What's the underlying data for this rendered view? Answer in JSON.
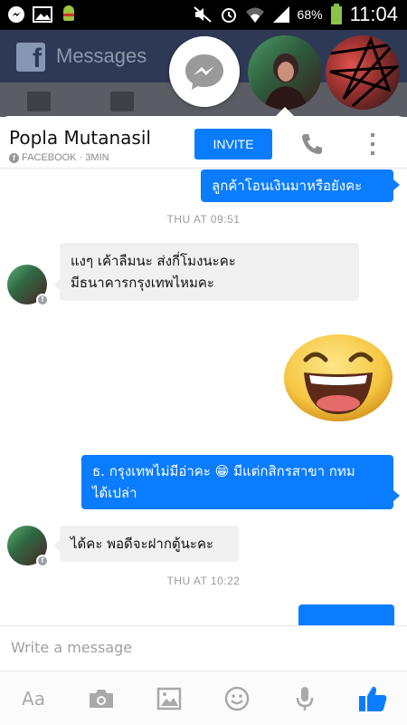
{
  "status_bar": {
    "battery_percent": "68%",
    "time": "11:04"
  },
  "background_app": {
    "logo_letter": "f",
    "title": "Messages"
  },
  "chat": {
    "contact_name": "Popla Mutanasil",
    "contact_source": "FACEBOOK · 3MIN",
    "invite_label": "INVITE",
    "messages": [
      {
        "direction": "out",
        "text": "ลูกค้าโอนเงินมาหรือยังคะ"
      },
      {
        "type": "timestamp",
        "text": "THU AT 09:51"
      },
      {
        "direction": "in",
        "lines": [
          "แงๆ เค้าลืมนะ ส่งกี่โมงนะคะ",
          "มีธนาคารกรุงเทพไหมคะ"
        ]
      },
      {
        "direction": "out",
        "type": "sticker",
        "name": "laughing-face"
      },
      {
        "direction": "out",
        "lines": [
          "ธ. กรุงเทพไม่มีอ่าคะ 😁 มีแต่กสิกรสาขา กทม",
          "ได้เปล่า"
        ]
      },
      {
        "direction": "in",
        "text": "ได้คะ พอดีจะฝากตู้นะคะ"
      },
      {
        "type": "timestamp",
        "text": "THU AT 10:22"
      }
    ]
  },
  "composer": {
    "placeholder": "Write a message",
    "text_button": "Aa"
  },
  "colors": {
    "accent": "#0a7cff",
    "incoming_bubble": "#f1f0f0",
    "header_dim": "#2e3a55"
  },
  "icons": [
    "messenger-icon",
    "phone-icon",
    "more-vertical-icon",
    "camera-icon",
    "gallery-icon",
    "emoji-icon",
    "microphone-icon",
    "like-icon"
  ]
}
